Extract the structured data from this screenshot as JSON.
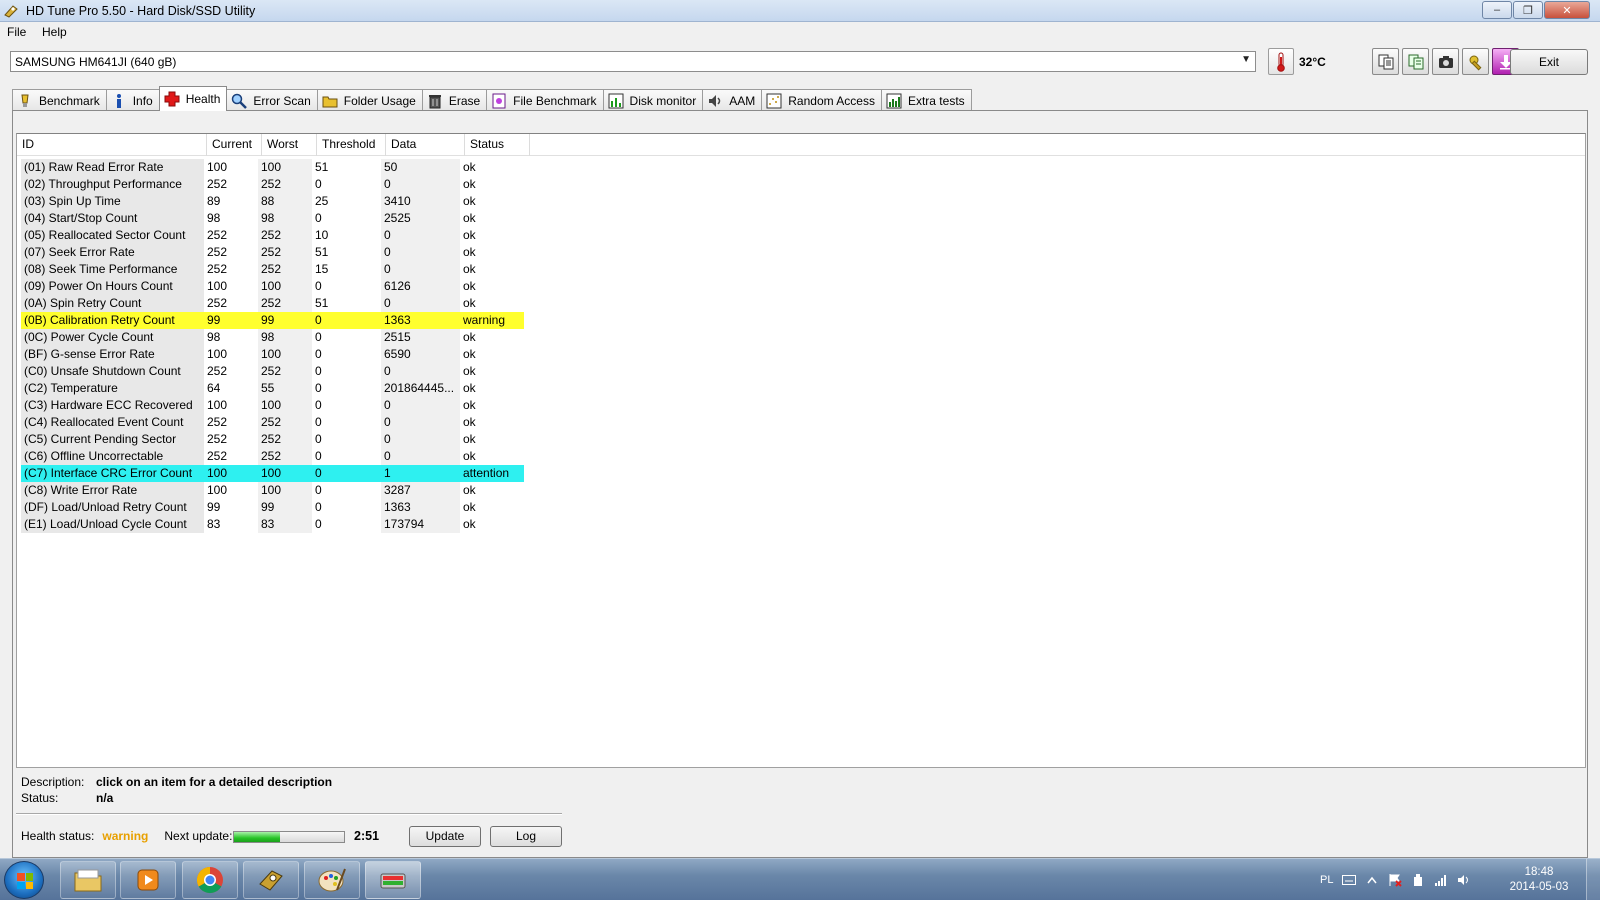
{
  "window": {
    "title": "HD Tune Pro 5.50 - Hard Disk/SSD Utility",
    "minimize_label": "–",
    "maximize_label": "❐",
    "close_label": "✕"
  },
  "menu": {
    "file": "File",
    "help": "Help"
  },
  "toolbar": {
    "drive": "SAMSUNG HM641JI (640 gB)",
    "dropdown_arrow": "▼",
    "temperature": "32°C",
    "exit_label": "Exit"
  },
  "tabs": [
    {
      "label": "Benchmark",
      "icon": "benchmark-icon"
    },
    {
      "label": "Info",
      "icon": "info-icon"
    },
    {
      "label": "Health",
      "icon": "health-cross-icon",
      "active": true
    },
    {
      "label": "Error Scan",
      "icon": "magnifier-icon"
    },
    {
      "label": "Folder Usage",
      "icon": "folder-icon"
    },
    {
      "label": "Erase",
      "icon": "trash-icon"
    },
    {
      "label": "File Benchmark",
      "icon": "file-benchmark-icon"
    },
    {
      "label": "Disk monitor",
      "icon": "disk-monitor-icon"
    },
    {
      "label": "AAM",
      "icon": "speaker-icon"
    },
    {
      "label": "Random Access",
      "icon": "random-access-icon"
    },
    {
      "label": "Extra tests",
      "icon": "extra-tests-icon"
    }
  ],
  "table": {
    "headers": [
      "ID",
      "Current",
      "Worst",
      "Threshold",
      "Data",
      "Status"
    ],
    "rows": [
      [
        "(01) Raw Read Error Rate",
        "100",
        "100",
        "51",
        "50",
        "ok"
      ],
      [
        "(02) Throughput Performance",
        "252",
        "252",
        "0",
        "0",
        "ok"
      ],
      [
        "(03) Spin Up Time",
        "89",
        "88",
        "25",
        "3410",
        "ok"
      ],
      [
        "(04) Start/Stop Count",
        "98",
        "98",
        "0",
        "2525",
        "ok"
      ],
      [
        "(05) Reallocated Sector Count",
        "252",
        "252",
        "10",
        "0",
        "ok"
      ],
      [
        "(07) Seek Error Rate",
        "252",
        "252",
        "51",
        "0",
        "ok"
      ],
      [
        "(08) Seek Time Performance",
        "252",
        "252",
        "15",
        "0",
        "ok"
      ],
      [
        "(09) Power On Hours Count",
        "100",
        "100",
        "0",
        "6126",
        "ok"
      ],
      [
        "(0A) Spin Retry Count",
        "252",
        "252",
        "51",
        "0",
        "ok"
      ],
      [
        "(0B) Calibration Retry Count",
        "99",
        "99",
        "0",
        "1363",
        "warning"
      ],
      [
        "(0C) Power Cycle Count",
        "98",
        "98",
        "0",
        "2515",
        "ok"
      ],
      [
        "(BF) G-sense Error Rate",
        "100",
        "100",
        "0",
        "6590",
        "ok"
      ],
      [
        "(C0) Unsafe Shutdown Count",
        "252",
        "252",
        "0",
        "0",
        "ok"
      ],
      [
        "(C2) Temperature",
        "64",
        "55",
        "0",
        "201864445...",
        "ok"
      ],
      [
        "(C3) Hardware ECC Recovered",
        "100",
        "100",
        "0",
        "0",
        "ok"
      ],
      [
        "(C4) Reallocated Event Count",
        "252",
        "252",
        "0",
        "0",
        "ok"
      ],
      [
        "(C5) Current Pending Sector",
        "252",
        "252",
        "0",
        "0",
        "ok"
      ],
      [
        "(C6) Offline Uncorrectable",
        "252",
        "252",
        "0",
        "0",
        "ok"
      ],
      [
        "(C7) Interface CRC Error Count",
        "100",
        "100",
        "0",
        "1",
        "attention"
      ],
      [
        "(C8) Write Error Rate",
        "100",
        "100",
        "0",
        "3287",
        "ok"
      ],
      [
        "(DF) Load/Unload Retry Count",
        "99",
        "99",
        "0",
        "1363",
        "ok"
      ],
      [
        "(E1) Load/Unload Cycle Count",
        "83",
        "83",
        "0",
        "173794",
        "ok"
      ]
    ]
  },
  "description": {
    "label": "Description:",
    "value": "click on an item for a detailed description",
    "status_label": "Status:",
    "status_value": "n/a"
  },
  "health": {
    "label": "Health status:",
    "value": "warning",
    "next_update_label": "Next update:",
    "progress_fraction": 0.42,
    "countdown": "2:51",
    "update_label": "Update",
    "log_label": "Log"
  },
  "colors": {
    "warning_row": "#ffff2e",
    "attention_row": "#2ef0f0",
    "health_warning_text": "#e8a000"
  },
  "taskbar": {
    "language": "PL",
    "time": "18:48",
    "date": "2014-05-03"
  }
}
